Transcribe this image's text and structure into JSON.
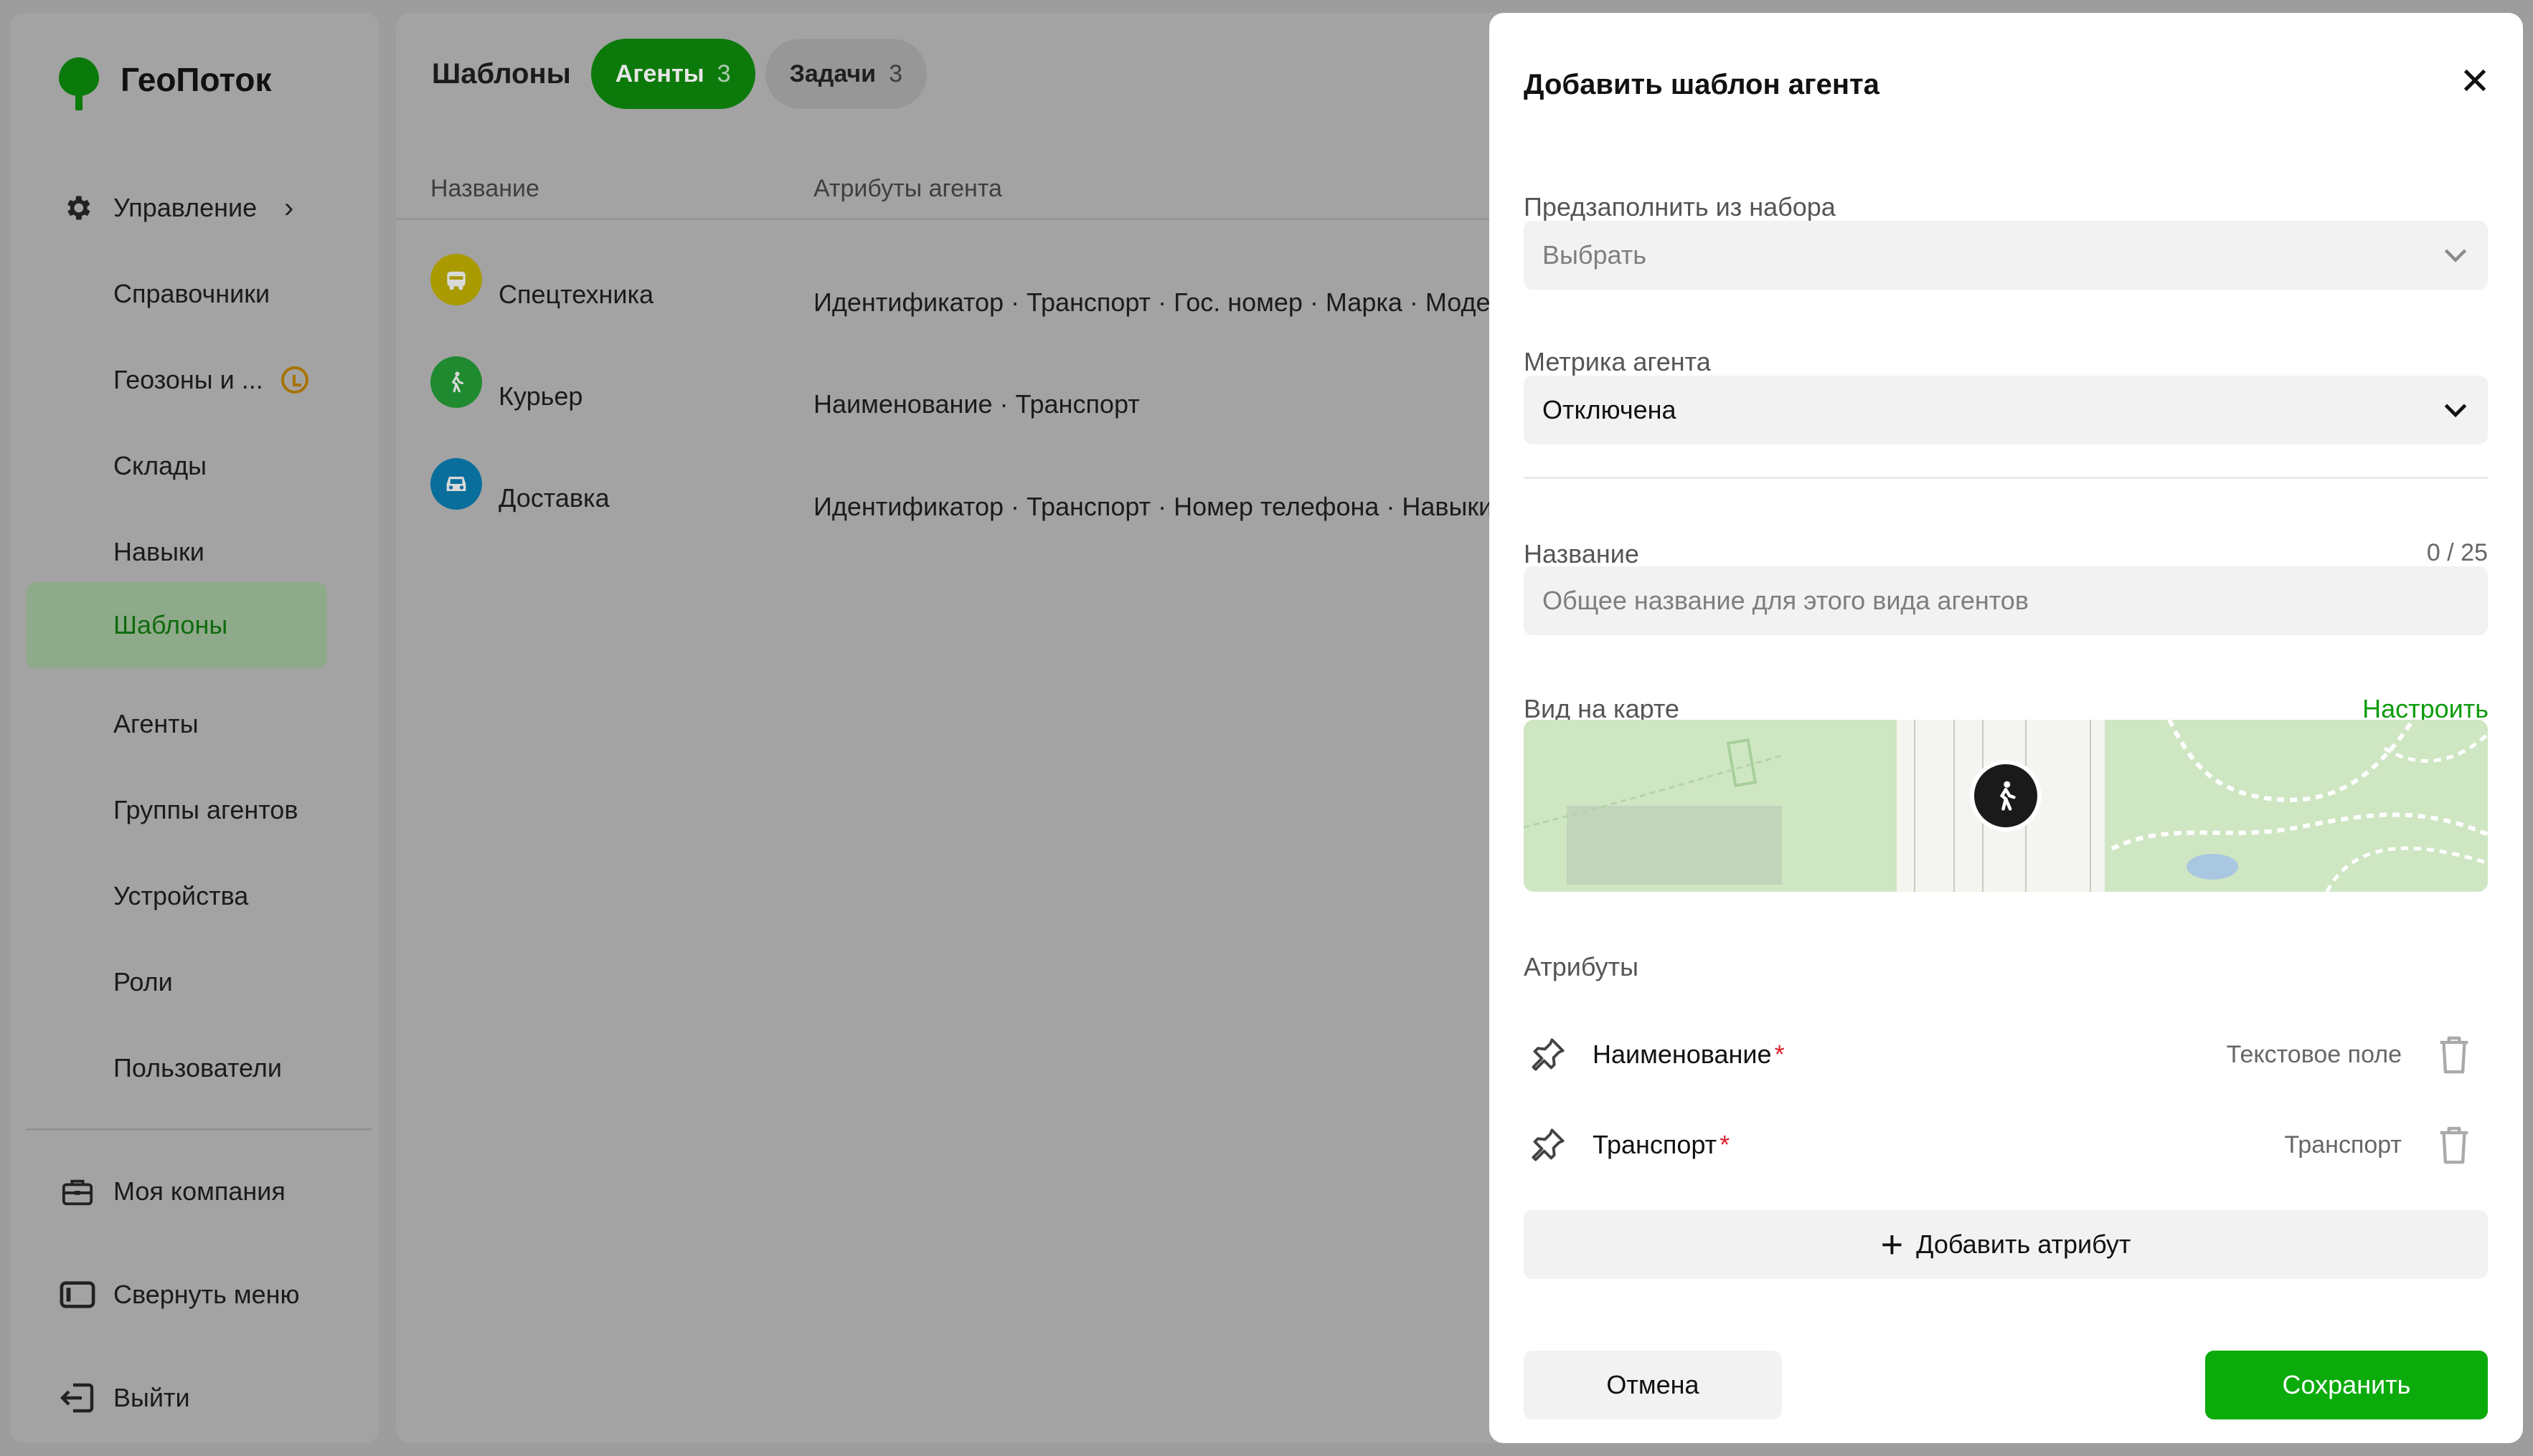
{
  "app": {
    "name": "ГеоПоток"
  },
  "sidebar": {
    "items": [
      {
        "label": "Управление",
        "icon": "gear-icon"
      },
      {
        "label": "Справочники"
      },
      {
        "label": "Геозоны и ..."
      },
      {
        "label": "Склады"
      },
      {
        "label": "Навыки"
      },
      {
        "label": "Шаблоны"
      },
      {
        "label": "Агенты"
      },
      {
        "label": "Группы агентов"
      },
      {
        "label": "Устройства"
      },
      {
        "label": "Роли"
      },
      {
        "label": "Пользователи"
      }
    ],
    "bottom": [
      {
        "label": "Моя компания",
        "icon": "briefcase-icon"
      },
      {
        "label": "Свернуть меню",
        "icon": "collapse-sidebar-icon"
      },
      {
        "label": "Выйти",
        "icon": "logout-icon"
      }
    ],
    "active_item": "Шаблоны",
    "accent_color": "#0b7a0b"
  },
  "main": {
    "title": "Шаблоны",
    "tabs": [
      {
        "label": "Агенты",
        "count": "3"
      },
      {
        "label": "Задачи",
        "count": "3"
      }
    ],
    "columns": [
      "Название",
      "Атрибуты агента"
    ],
    "rows": [
      {
        "name": "Спецтехника",
        "icon": "truck-icon",
        "icon_color": "#a89a00",
        "attributes": "Идентификатор · Транспорт · Гос. номер · Марка · Модель"
      },
      {
        "name": "Курьер",
        "icon": "walker-icon",
        "icon_color": "#1f8a2f",
        "attributes": "Наименование · Транспорт"
      },
      {
        "name": "Доставка",
        "icon": "car-icon",
        "icon_color": "#0a6e9c",
        "attributes": "Идентификатор · Транспорт · Номер телефона · Навыки"
      }
    ]
  },
  "panel": {
    "title": "Добавить шаблон агента",
    "prefill": {
      "label": "Предзаполнить из набора",
      "placeholder": "Выбрать"
    },
    "metric": {
      "label": "Метрика агента",
      "value": "Отключена"
    },
    "name": {
      "label": "Название",
      "counter": "0 / 25",
      "placeholder": "Общее название для этого вида агентов"
    },
    "map_view": {
      "label": "Вид на карте",
      "action": "Настроить"
    },
    "attributes": {
      "label": "Атрибуты",
      "items": [
        {
          "name": "Наименование",
          "required": "*",
          "type": "Текстовое поле"
        },
        {
          "name": "Транспорт",
          "required": "*",
          "type": "Транспорт"
        }
      ],
      "add_label": "Добавить атрибут"
    },
    "cancel_label": "Отмена",
    "save_label": "Сохранить",
    "save_color": "#0cab0c"
  }
}
